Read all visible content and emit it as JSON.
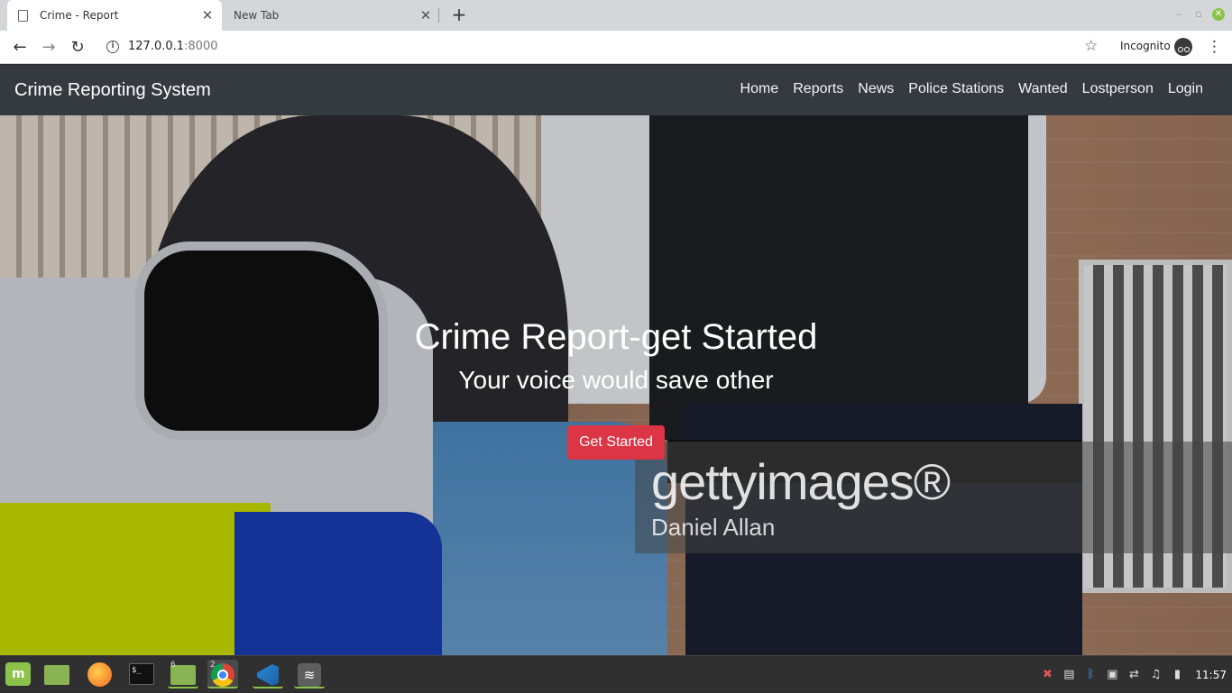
{
  "browser": {
    "tabs": [
      {
        "title": "Crime - Report",
        "active": true
      },
      {
        "title": "New Tab",
        "active": false
      }
    ],
    "address": {
      "host": "127.0.0.1",
      "port": ":8000"
    },
    "incognito_label": "Incognito"
  },
  "site": {
    "brand": "Crime Reporting System",
    "nav": [
      "Home",
      "Reports",
      "News",
      "Police Stations",
      "Wanted",
      "Lostperson",
      "Login"
    ],
    "hero": {
      "title": "Crime Report-get Started",
      "subtitle": "Your voice would save other",
      "cta_label": "Get Started",
      "watermark_logo": "gettyimages®",
      "watermark_credit": "Daniel Allan"
    },
    "colors": {
      "navbar": "#343a40",
      "cta": "#dc3545"
    }
  },
  "taskbar": {
    "badges": {
      "files": "6",
      "chrome": "2"
    },
    "clock": "11:57"
  }
}
